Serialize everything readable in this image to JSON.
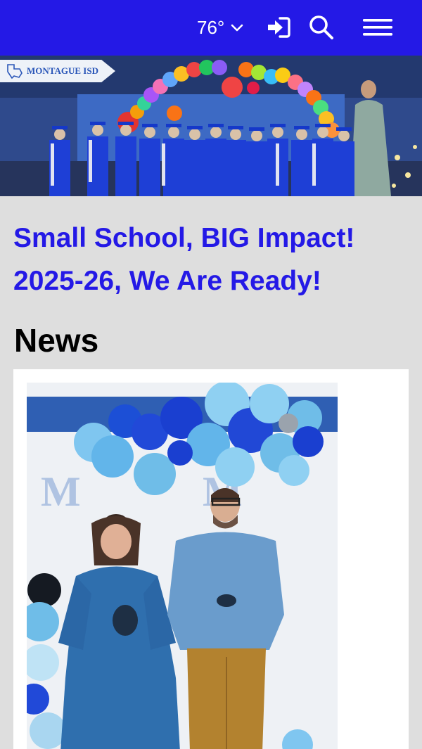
{
  "header": {
    "temperature": "76°",
    "icons": [
      "chevron-down-icon",
      "sign-in-icon",
      "search-icon",
      "hamburger-menu-icon"
    ],
    "bar_color": "#2419e6"
  },
  "hero": {
    "logo_text": "MONTAGUE ISD"
  },
  "headline": {
    "line1": "Small School, BIG Impact!",
    "line2": "2025-26, We Are Ready!",
    "color": "#2419e6"
  },
  "news": {
    "heading": "News"
  }
}
